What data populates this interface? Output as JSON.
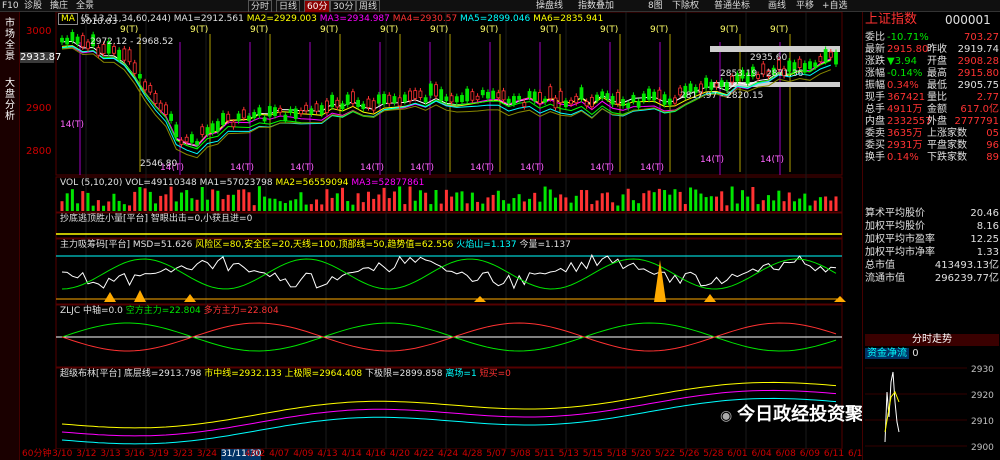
{
  "toolbar": {
    "f10": "F10",
    "diagnose": "诊股",
    "capture": "擒庄",
    "panorama": "全景",
    "periods": [
      "分时",
      "日线",
      "60分",
      "30分",
      "周线"
    ],
    "active_period": "60分",
    "right": [
      "操盘线",
      "指数叠加",
      "8图",
      "下除权",
      "普通坐标",
      "画线",
      "平移",
      "+自选"
    ]
  },
  "sidestrip": {
    "top": "市场全景",
    "bottom": "大盘分析"
  },
  "main_header": {
    "ma_tag": "MA",
    "params": "(5,13,21,34,60,244)",
    "ma1": "MA1=2912.561",
    "ma2": "MA2=2929.003",
    "ma3": "MA3=2934.987",
    "ma4": "MA4=2930.57",
    "ma5": "MA5=2899.046",
    "ma6": "MA6=2835.941"
  },
  "price_axis": [
    "3000",
    "2933.87",
    "2900",
    "2800",
    "2700"
  ],
  "price_marks": [
    "3010.03",
    "2972.12 - 2968.52",
    "2546.80",
    "2935.60",
    "2853.19 - 2871.36",
    "2817.97 - 2820.15"
  ],
  "markers_9t": "9(T)",
  "markers_14t": "14(T)",
  "vol_header": {
    "name": "VOL",
    "params": "(5,10,20)",
    "vol": "VOL=49110348",
    "ma1": "MA1=57023798",
    "ma2": "MA2=56559094",
    "ma3": "MA3=52877861"
  },
  "bottom_header": {
    "name": "抄底逃顶胜小量[平台]",
    "text": "智眼出击=0,小获且进=0"
  },
  "flow_header": {
    "name": "主力吸筹码[平台]",
    "msd": "MSD=51.626",
    "risk": "风险区=80,安全区=20,天线=100,顶部线=50,趋势值=62.556",
    "fire": "火焰山=1.137",
    "vol": "今量=1.137"
  },
  "zljc_header": {
    "name": "ZLJC",
    "axis": "中轴=0.0",
    "empty": "空方主力=22.804",
    "many": "多方主力=22.804"
  },
  "market_header": {
    "name": "超级布林[平台]",
    "base": "底层线=2913.798",
    "center": "市中线=2932.133",
    "upper": "上极限=2964.408",
    "lower": "下极限=2899.858",
    "field": "离场=1",
    "buy": "短买=0"
  },
  "dates": [
    "60分钟",
    "3/10",
    "3/12",
    "3/13",
    "3/16",
    "3/19",
    "3/23",
    "3/24",
    "31/11:30",
    "4/02",
    "4/07",
    "4/09",
    "4/13",
    "4/14",
    "4/16",
    "4/20",
    "4/22",
    "4/24",
    "4/28",
    "5/07",
    "5/08",
    "5/11",
    "5/13",
    "5/15",
    "5/18",
    "5/20",
    "5/22",
    "5/26",
    "5/28",
    "6/01",
    "6/04",
    "6/08",
    "6/09",
    "6/11",
    "6/15"
  ],
  "info": {
    "title": "上证指数",
    "code": "000001",
    "rows": [
      {
        "l": "委比",
        "v": "-10.71%",
        "r": "703.27"
      },
      {
        "l": "最新",
        "v": "2915.80",
        "r2l": "昨收",
        "r": "2919.74"
      },
      {
        "l": "涨跌",
        "v": "▼3.94",
        "r2l": "开盘",
        "r": "2908.28"
      },
      {
        "l": "涨幅",
        "v": "-0.14%",
        "r2l": "最高",
        "r": "2915.80"
      },
      {
        "l": "振幅",
        "v": "0.34%",
        "r2l": "最低",
        "r": "2905.75"
      },
      {
        "l": "现手",
        "v": "367421",
        "r2l": "量比",
        "r": "2.77"
      },
      {
        "l": "总手",
        "v": "4911万",
        "r2l": "金额",
        "r": "617.0亿"
      },
      {
        "l": "内盘",
        "v": "2332557",
        "r2l": "外盘",
        "r": "2777791"
      },
      {
        "l": "委卖",
        "v": "3635万",
        "r2l": "上涨家数",
        "r": "05"
      },
      {
        "l": "委买",
        "v": "2931万",
        "r2l": "平盘家数",
        "r": "96"
      },
      {
        "l": "换手",
        "v": "0.14%",
        "r2l": "下跌家数",
        "r": "89"
      }
    ],
    "stats": [
      {
        "l": "算术平均股价",
        "r": "20.46"
      },
      {
        "l": "加权平均股价",
        "r": "8.16"
      },
      {
        "l": "加权平均市盈率",
        "r": "12.25"
      },
      {
        "l": "加权平均市净率",
        "r": "1.33"
      },
      {
        "l": "总市值",
        "r": "413493.13亿"
      },
      {
        "l": "流通市值",
        "r": "296239.77亿"
      }
    ],
    "tab": "分时走势",
    "flow_label": "资金净流",
    "flow_value": "0",
    "mini_axis": [
      "2930",
      "2920",
      "2910",
      "2900"
    ]
  },
  "watermark": "今日政经投资聚焦",
  "colors": {
    "up": "#ff3232",
    "down": "#00e600",
    "bg": "#000000",
    "accent": "#8b0000"
  }
}
